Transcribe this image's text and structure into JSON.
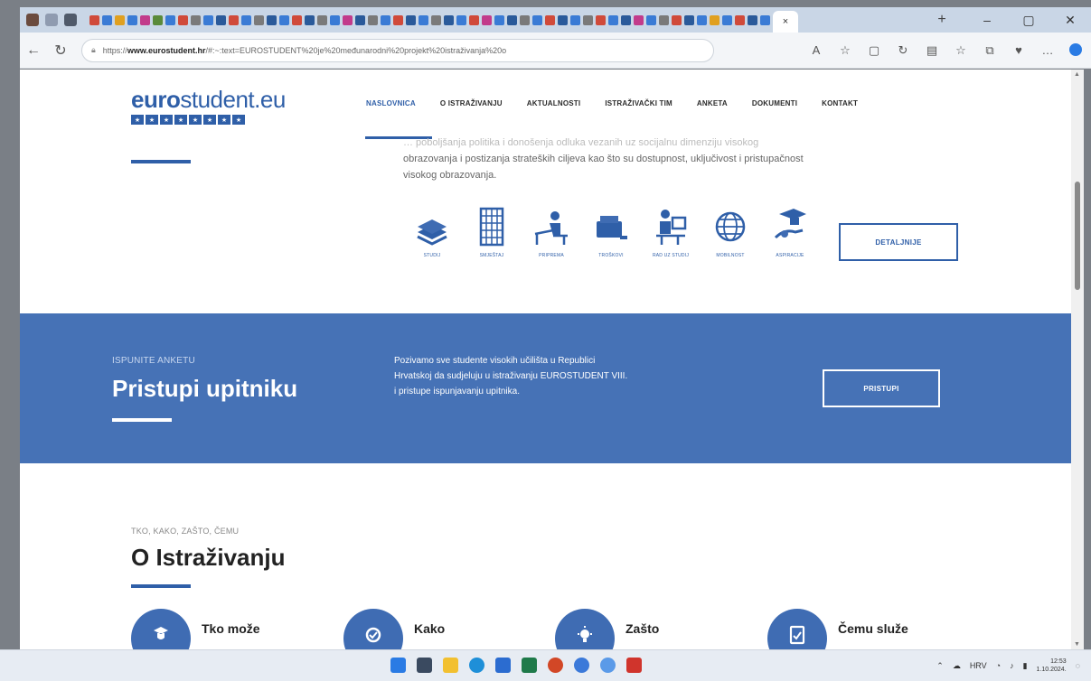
{
  "browser": {
    "url_prefix": "https://",
    "url_domain": "www.eurostudent.hr",
    "url_rest": "/#:~:text=EUROSTUDENT%20je%20međunarodni%20projekt%20istraživanja%20o",
    "tab_close": "×",
    "new_tab": "+",
    "window_controls": [
      "–",
      "▢",
      "✕"
    ]
  },
  "site": {
    "logo_bold": "euro",
    "logo_rest": "student.eu",
    "nav": [
      "NASLOVNICA",
      "O ISTRAŽIVANJU",
      "AKTUALNOSTI",
      "ISTRAŽIVAČKI TIM",
      "ANKETA",
      "DOKUMENTI",
      "KONTAKT"
    ]
  },
  "intro": {
    "line1": "… poboljšanja politika i donošenja odluka vezanih uz socijalnu dimenziju visokog",
    "line2": "obrazovanja i postizanja strateških ciljeva kao što su dostupnost, uključivost i pristupačnost",
    "line3": "visokog obrazovanja."
  },
  "icons": [
    {
      "caption": "STUDIJ",
      "icon": "books-icon"
    },
    {
      "caption": "SMJEŠTAJ",
      "icon": "building-icon"
    },
    {
      "caption": "PRIPREMA",
      "icon": "desk-study-icon"
    },
    {
      "caption": "TROŠKOVI",
      "icon": "wallet-icon"
    },
    {
      "caption": "RAD UZ STUDIJ",
      "icon": "work-icon"
    },
    {
      "caption": "MOBILNOST",
      "icon": "globe-icon"
    },
    {
      "caption": "ASPIRACIJE",
      "icon": "graduation-icon"
    }
  ],
  "details_button": "DETALJNIJE",
  "banner": {
    "label": "ISPUNITE ANKETU",
    "title": "Pristupi upitniku",
    "text_line1": "Pozivamo sve studente visokih učilišta u Republici",
    "text_line2": "Hrvatskoj da sudjeluju u istraživanju EUROSTUDENT VIII.",
    "text_line3": "i pristupe ispunjavanju upitnika.",
    "button": "PRISTUPI"
  },
  "section": {
    "label": "TKO, KAKO, ZAŠTO, ČEMU",
    "title": "O Istraživanju",
    "features": [
      "Tko može",
      "Kako",
      "Zašto",
      "Čemu služe"
    ]
  },
  "taskbar": {
    "tray_lang": "HRV",
    "tray_symbols": "⌃",
    "time": "12:53",
    "date": "1.10.2024."
  },
  "colors": {
    "brand_blue": "#2f5fa8",
    "banner_blue": "#4672b6"
  }
}
